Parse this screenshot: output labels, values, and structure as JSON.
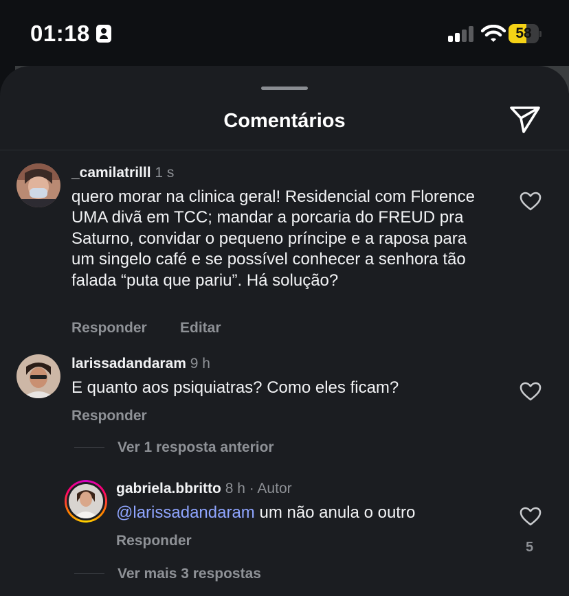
{
  "status_bar": {
    "time": "01:18",
    "battery_level": "58",
    "battery_percent": 58,
    "signal_bars_active": 2,
    "signal_bars_total": 4,
    "icons": [
      "id-card-icon",
      "cellular-signal-icon",
      "wifi-icon",
      "battery-icon"
    ],
    "colors": {
      "battery_fill": "#f5d216"
    }
  },
  "sheet": {
    "title": "Comentários",
    "share_icon": "paper-plane-icon"
  },
  "comments": [
    {
      "username": "_camilatrilll",
      "time": "1 s",
      "text": "quero morar na clinica geral! Residencial com Florence UMA divã  em TCC; mandar a porcaria do FREUD pra Saturno, convidar o pequeno príncipe e a raposa para um singelo café e se possível conhecer a senhora tão falada “puta que pariu”. Há solução?",
      "actions": [
        "Responder",
        "Editar"
      ],
      "like_icon": "heart-outline-icon"
    },
    {
      "username": "larissadandaram",
      "time": "9 h",
      "text": "E quanto aos psiquiatras? Como eles  ficam?",
      "actions": [
        "Responder"
      ],
      "like_icon": "heart-outline-icon",
      "view_previous": "Ver 1 resposta anterior",
      "reply": {
        "username": "gabriela.bbritto",
        "time": "8 h",
        "author_badge": "· Autor",
        "mention": "@larissadandaram",
        "text": " um não anula o outro",
        "actions": [
          "Responder"
        ],
        "likes": "5",
        "like_icon": "heart-outline-icon"
      },
      "view_more": "Ver mais 3 respostas"
    }
  ],
  "colors": {
    "sheet_background": "#1b1d21",
    "page_background": "#0e1013",
    "secondary_text": "#8e9196",
    "mention": "#8fa5ff"
  }
}
